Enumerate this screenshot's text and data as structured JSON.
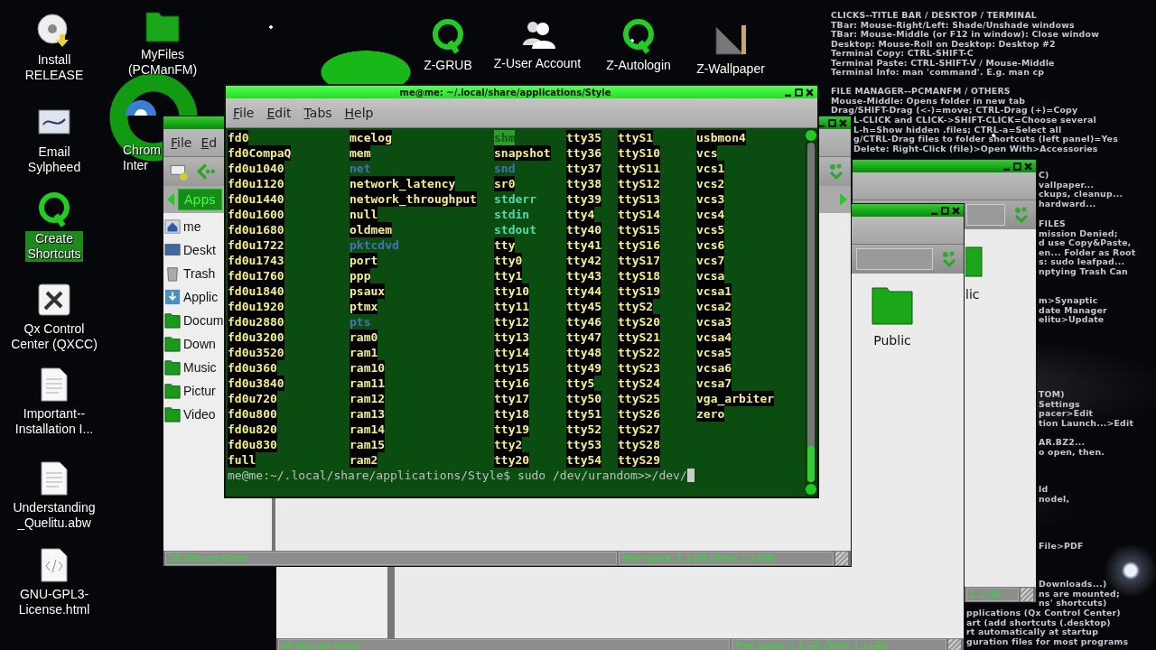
{
  "desktop_icons": [
    {
      "label": "Install\nRELEASE",
      "selected": false
    },
    {
      "label": "MyFiles\n(PCManFM)",
      "selected": false
    },
    {
      "label": "Email\nSylpheed",
      "selected": false
    },
    {
      "label": "Chrom\nInter",
      "selected": false
    },
    {
      "label": "Create\nShortcuts",
      "selected": true
    },
    {
      "label": "Qx Control\nCenter (QXCC)",
      "selected": false
    },
    {
      "label": "Important--\nInstallation I...",
      "selected": false
    },
    {
      "label": "Understanding\n_Quelitu.abw",
      "selected": false
    },
    {
      "label": "GNU-GPL3-\nLicense.html",
      "selected": false
    },
    {
      "label": "Z-GRUB",
      "selected": false
    },
    {
      "label": "Z-User Account",
      "selected": false
    },
    {
      "label": "Z-Autologin",
      "selected": false
    },
    {
      "label": "Z-Wallpaper",
      "selected": false
    }
  ],
  "notes": [
    [
      "CLICKS--TITLE BAR / DESKTOP / TERMINAL",
      "TBar: Mouse-Right/Left: Shade/Unshade windows",
      "TBar: Mouse-Middle (or F12 in window): Close window",
      "Desktop: Mouse-Roll on Desktop: Desktop #2",
      "Terminal Copy: CTRL-SHIFT-C",
      "Terminal Paste: CTRL-SHIFT-V / Mouse-Middle",
      "Terminal Info: man 'command'. E.g. man cp"
    ],
    [
      "FILE MANAGER--PCMANFM / OTHERS",
      "Mouse-Middle: Opens folder in new tab",
      "Drag/SHIFT-Drag (<-)=move; CTRL-Drag (+)=Copy"
    ],
    [
      "L-CLICK and CLICK->SHIFT-CLICK=Choose several",
      "L-h=Show hidden .files; CTRL-a=Select all",
      "g/CTRL-Drag files to folder shortcuts (left panel)=Yes",
      "Delete: Right-Click (file)>Open With>Accessories"
    ],
    [
      "C)",
      "vallpaper...",
      "ckups, cleanup...",
      "hardward..."
    ],
    [
      "FILES",
      "mission Denied;",
      "d use Copy&Paste,",
      "en... Folder as Root",
      "s: sudo leafpad...",
      "nptying Trash Can"
    ],
    [
      "m>Synaptic",
      "date Manager",
      "elitu>Update"
    ],
    [
      "TOM)",
      "Settings",
      "pacer>Edit",
      "tion Launch...>Edit"
    ],
    [
      "AR.BZ2...",
      "o open, then."
    ],
    [
      "ld",
      "nodel,"
    ],
    [
      "File>PDF"
    ],
    [
      "Downloads...)",
      "ns are mounted;",
      "ns' shortcuts)"
    ],
    [
      "pplications (Qx Control Center)",
      "art (add shortcuts (.desktop)",
      "rt automatically at startup",
      "guration files for most programs"
    ]
  ],
  "back_window": {
    "folder_label": "lic",
    "status_right": "1.1 GB"
  },
  "middle_window": {
    "folder_label": "Public",
    "status_left": "45 files are listed",
    "status_right": "Free space: 1.1 GB (Total: 1.1 GB)"
  },
  "file_manager": {
    "menu": [
      "File",
      "Ed"
    ],
    "path_button": "Apps",
    "sidebar": [
      {
        "label": "me"
      },
      {
        "label": "Deskt"
      },
      {
        "label": "Trash"
      },
      {
        "label": "Applic"
      },
      {
        "label": "Docum"
      },
      {
        "label": "Down"
      },
      {
        "label": "Music"
      },
      {
        "label": "Pictur"
      },
      {
        "label": "Video"
      }
    ],
    "status_left": "10 files are listed",
    "status_right": "Free space: 1.1 GB (Total: 1.1 GB)"
  },
  "terminal": {
    "title": "me@me: ~/.local/share/applications/Style",
    "menu": [
      "File",
      "Edit",
      "Tabs",
      "Help"
    ],
    "columns": [
      [
        {
          "name": "fd0",
          "kind": "device"
        },
        {
          "name": "fd0CompaQ",
          "kind": "device"
        },
        {
          "name": "fd0u1040",
          "kind": "device"
        },
        {
          "name": "fd0u1120",
          "kind": "device"
        },
        {
          "name": "fd0u1440",
          "kind": "device"
        },
        {
          "name": "fd0u1600",
          "kind": "device"
        },
        {
          "name": "fd0u1680",
          "kind": "device"
        },
        {
          "name": "fd0u1722",
          "kind": "device"
        },
        {
          "name": "fd0u1743",
          "kind": "device"
        },
        {
          "name": "fd0u1760",
          "kind": "device"
        },
        {
          "name": "fd0u1840",
          "kind": "device"
        },
        {
          "name": "fd0u1920",
          "kind": "device"
        },
        {
          "name": "fd0u2880",
          "kind": "device"
        },
        {
          "name": "fd0u3200",
          "kind": "device"
        },
        {
          "name": "fd0u3520",
          "kind": "device"
        },
        {
          "name": "fd0u360",
          "kind": "device"
        },
        {
          "name": "fd0u3840",
          "kind": "device"
        },
        {
          "name": "fd0u720",
          "kind": "device"
        },
        {
          "name": "fd0u800",
          "kind": "device"
        },
        {
          "name": "fd0u820",
          "kind": "device"
        },
        {
          "name": "fd0u830",
          "kind": "device"
        },
        {
          "name": "full",
          "kind": "device"
        }
      ],
      [
        {
          "name": "mcelog",
          "kind": "device"
        },
        {
          "name": "mem",
          "kind": "device"
        },
        {
          "name": "net",
          "kind": "dir"
        },
        {
          "name": "network_latency",
          "kind": "device"
        },
        {
          "name": "network_throughput",
          "kind": "device"
        },
        {
          "name": "null",
          "kind": "device"
        },
        {
          "name": "oldmem",
          "kind": "device"
        },
        {
          "name": "pktcdvd",
          "kind": "dir"
        },
        {
          "name": "port",
          "kind": "device"
        },
        {
          "name": "ppp",
          "kind": "device"
        },
        {
          "name": "psaux",
          "kind": "device"
        },
        {
          "name": "ptmx",
          "kind": "device"
        },
        {
          "name": "pts",
          "kind": "dir"
        },
        {
          "name": "ram0",
          "kind": "device"
        },
        {
          "name": "ram1",
          "kind": "device"
        },
        {
          "name": "ram10",
          "kind": "device"
        },
        {
          "name": "ram11",
          "kind": "device"
        },
        {
          "name": "ram12",
          "kind": "device"
        },
        {
          "name": "ram13",
          "kind": "device"
        },
        {
          "name": "ram14",
          "kind": "device"
        },
        {
          "name": "ram15",
          "kind": "device"
        },
        {
          "name": "ram2",
          "kind": "device"
        }
      ],
      [
        {
          "name": "shm",
          "kind": "sticky"
        },
        {
          "name": "snapshot",
          "kind": "device"
        },
        {
          "name": "snd",
          "kind": "dir"
        },
        {
          "name": "sr0",
          "kind": "device"
        },
        {
          "name": "stderr",
          "kind": "link"
        },
        {
          "name": "stdin",
          "kind": "link"
        },
        {
          "name": "stdout",
          "kind": "link"
        },
        {
          "name": "tty",
          "kind": "device"
        },
        {
          "name": "tty0",
          "kind": "device"
        },
        {
          "name": "tty1",
          "kind": "device"
        },
        {
          "name": "tty10",
          "kind": "device"
        },
        {
          "name": "tty11",
          "kind": "device"
        },
        {
          "name": "tty12",
          "kind": "device"
        },
        {
          "name": "tty13",
          "kind": "device"
        },
        {
          "name": "tty14",
          "kind": "device"
        },
        {
          "name": "tty15",
          "kind": "device"
        },
        {
          "name": "tty16",
          "kind": "device"
        },
        {
          "name": "tty17",
          "kind": "device"
        },
        {
          "name": "tty18",
          "kind": "device"
        },
        {
          "name": "tty19",
          "kind": "device"
        },
        {
          "name": "tty2",
          "kind": "device"
        },
        {
          "name": "tty20",
          "kind": "device"
        }
      ],
      [
        {
          "name": "tty35",
          "kind": "device"
        },
        {
          "name": "tty36",
          "kind": "device"
        },
        {
          "name": "tty37",
          "kind": "device"
        },
        {
          "name": "tty38",
          "kind": "device"
        },
        {
          "name": "tty39",
          "kind": "device"
        },
        {
          "name": "tty4",
          "kind": "device"
        },
        {
          "name": "tty40",
          "kind": "device"
        },
        {
          "name": "tty41",
          "kind": "device"
        },
        {
          "name": "tty42",
          "kind": "device"
        },
        {
          "name": "tty43",
          "kind": "device"
        },
        {
          "name": "tty44",
          "kind": "device"
        },
        {
          "name": "tty45",
          "kind": "device"
        },
        {
          "name": "tty46",
          "kind": "device"
        },
        {
          "name": "tty47",
          "kind": "device"
        },
        {
          "name": "tty48",
          "kind": "device"
        },
        {
          "name": "tty49",
          "kind": "device"
        },
        {
          "name": "tty5",
          "kind": "device"
        },
        {
          "name": "tty50",
          "kind": "device"
        },
        {
          "name": "tty51",
          "kind": "device"
        },
        {
          "name": "tty52",
          "kind": "device"
        },
        {
          "name": "tty53",
          "kind": "device"
        },
        {
          "name": "tty54",
          "kind": "device"
        }
      ],
      [
        {
          "name": "ttyS1",
          "kind": "device"
        },
        {
          "name": "ttyS10",
          "kind": "device"
        },
        {
          "name": "ttyS11",
          "kind": "device"
        },
        {
          "name": "ttyS12",
          "kind": "device"
        },
        {
          "name": "ttyS13",
          "kind": "device"
        },
        {
          "name": "ttyS14",
          "kind": "device"
        },
        {
          "name": "ttyS15",
          "kind": "device"
        },
        {
          "name": "ttyS16",
          "kind": "device"
        },
        {
          "name": "ttyS17",
          "kind": "device"
        },
        {
          "name": "ttyS18",
          "kind": "device"
        },
        {
          "name": "ttyS19",
          "kind": "device"
        },
        {
          "name": "ttyS2",
          "kind": "device"
        },
        {
          "name": "ttyS20",
          "kind": "device"
        },
        {
          "name": "ttyS21",
          "kind": "device"
        },
        {
          "name": "ttyS22",
          "kind": "device"
        },
        {
          "name": "ttyS23",
          "kind": "device"
        },
        {
          "name": "ttyS24",
          "kind": "device"
        },
        {
          "name": "ttyS25",
          "kind": "device"
        },
        {
          "name": "ttyS26",
          "kind": "device"
        },
        {
          "name": "ttyS27",
          "kind": "device"
        },
        {
          "name": "ttyS28",
          "kind": "device"
        },
        {
          "name": "ttyS29",
          "kind": "device"
        }
      ],
      [
        {
          "name": "usbmon4",
          "kind": "device"
        },
        {
          "name": "vcs",
          "kind": "device"
        },
        {
          "name": "vcs1",
          "kind": "device"
        },
        {
          "name": "vcs2",
          "kind": "device"
        },
        {
          "name": "vcs3",
          "kind": "device"
        },
        {
          "name": "vcs4",
          "kind": "device"
        },
        {
          "name": "vcs5",
          "kind": "device"
        },
        {
          "name": "vcs6",
          "kind": "device"
        },
        {
          "name": "vcs7",
          "kind": "device"
        },
        {
          "name": "vcsa",
          "kind": "device"
        },
        {
          "name": "vcsa1",
          "kind": "device"
        },
        {
          "name": "vcsa2",
          "kind": "device"
        },
        {
          "name": "vcsa3",
          "kind": "device"
        },
        {
          "name": "vcsa4",
          "kind": "device"
        },
        {
          "name": "vcsa5",
          "kind": "device"
        },
        {
          "name": "vcsa6",
          "kind": "device"
        },
        {
          "name": "vcsa7",
          "kind": "device"
        },
        {
          "name": "vga_arbiter",
          "kind": "device"
        },
        {
          "name": "zero",
          "kind": "device"
        }
      ]
    ],
    "prompt": "me@me:~/.local/share/applications/Style$ sudo /dev/urandom>>/dev/"
  }
}
